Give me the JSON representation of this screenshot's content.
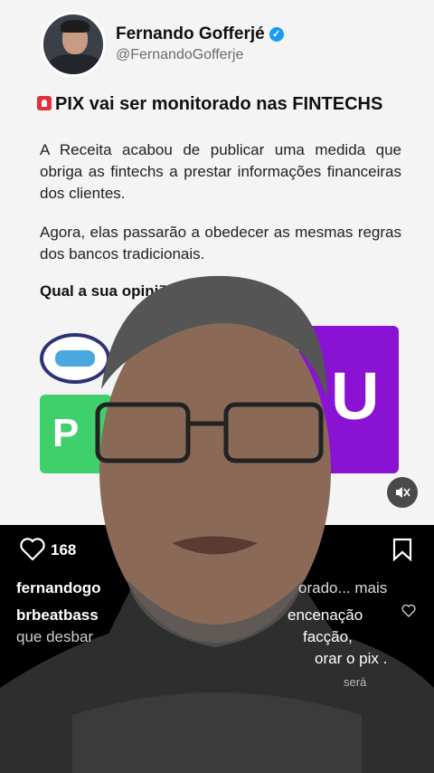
{
  "post": {
    "author_name": "Fernando Gofferjé",
    "author_handle": "@FernandoGofferje",
    "headline": "PIX vai ser monitorado nas FINTECHS",
    "paragraph1": "A Receita acabou de publicar uma medida que obriga as fintechs a prestar informações financeiras dos clientes.",
    "paragraph2": "Agora, elas passarão a obedecer as mesmas regras dos bancos tradicionais.",
    "question": "Qual a sua opinião?",
    "logo_pix_text": "P",
    "logo_nu_text": "U"
  },
  "actions": {
    "like_count": "168"
  },
  "comments": {
    "caption_user": "fernandogo",
    "caption_tail": "orado... mais",
    "c2_user": "brbeatbass",
    "c2_tail": "encenação",
    "c3_head": "que desbar",
    "c3_tail": "facção,",
    "c4_tail": "orar o pix .",
    "c5_tail": "será"
  },
  "icons": [
    "verified-icon",
    "siren-icon",
    "mute-icon",
    "heart-icon",
    "bookmark-icon"
  ],
  "colors": {
    "verified": "#1d9bf0",
    "pix": "#3fd06b",
    "nubank": "#8a12d3"
  }
}
